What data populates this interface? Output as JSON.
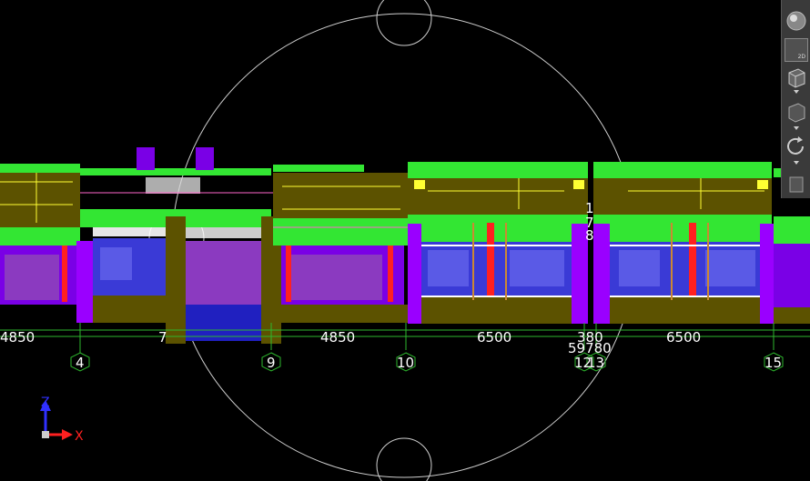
{
  "drawing": {
    "dimensions": {
      "d1": "4850",
      "d2": "7",
      "d3": "4850",
      "d4": "6500",
      "d5": "380",
      "d6": "6500",
      "total": "59780"
    },
    "grid_labels": [
      "4",
      "9",
      "10",
      "12",
      "13",
      "15"
    ],
    "mid_glyphs": [
      "1",
      "7",
      "8"
    ]
  },
  "ucs": {
    "z_label": "Z",
    "x_label": "X"
  },
  "navbar": {
    "zoom_label": "2D"
  },
  "colors": {
    "background": "#000000",
    "green_slab": "#33e633",
    "purple_wall": "#7a00e6",
    "olive_fill": "#5c5200",
    "blue_glass": "#3a3ad6",
    "red_column": "#ff2020",
    "grid_green": "#2eb82e",
    "white_line": "#ffffff",
    "ucs_z": "#3030ff",
    "ucs_x": "#ff2020"
  }
}
